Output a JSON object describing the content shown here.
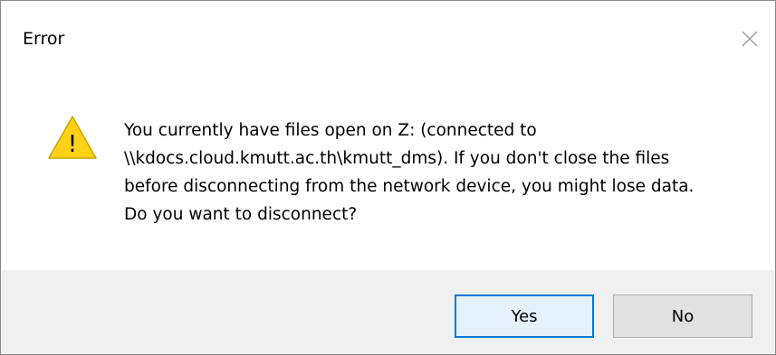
{
  "window": {
    "title": "Error",
    "close_icon": "close-icon"
  },
  "dialog": {
    "icon": "warning-icon",
    "icon_glyph": "!",
    "message": "You currently have files open on Z: (connected to\n\\\\kdocs.cloud.kmutt.ac.th\\kmutt_dms). If you don't close the files\nbefore disconnecting from the network device, you might lose data.\nDo you want to disconnect?"
  },
  "buttons": {
    "yes_label": "Yes",
    "no_label": "No"
  },
  "colors": {
    "warning_fill": "#FCD116",
    "warning_stroke": "#9a7a00",
    "default_button_border": "#0078d7",
    "default_button_bg": "#e5f1fb",
    "footer_bg": "#f0f0f0"
  }
}
